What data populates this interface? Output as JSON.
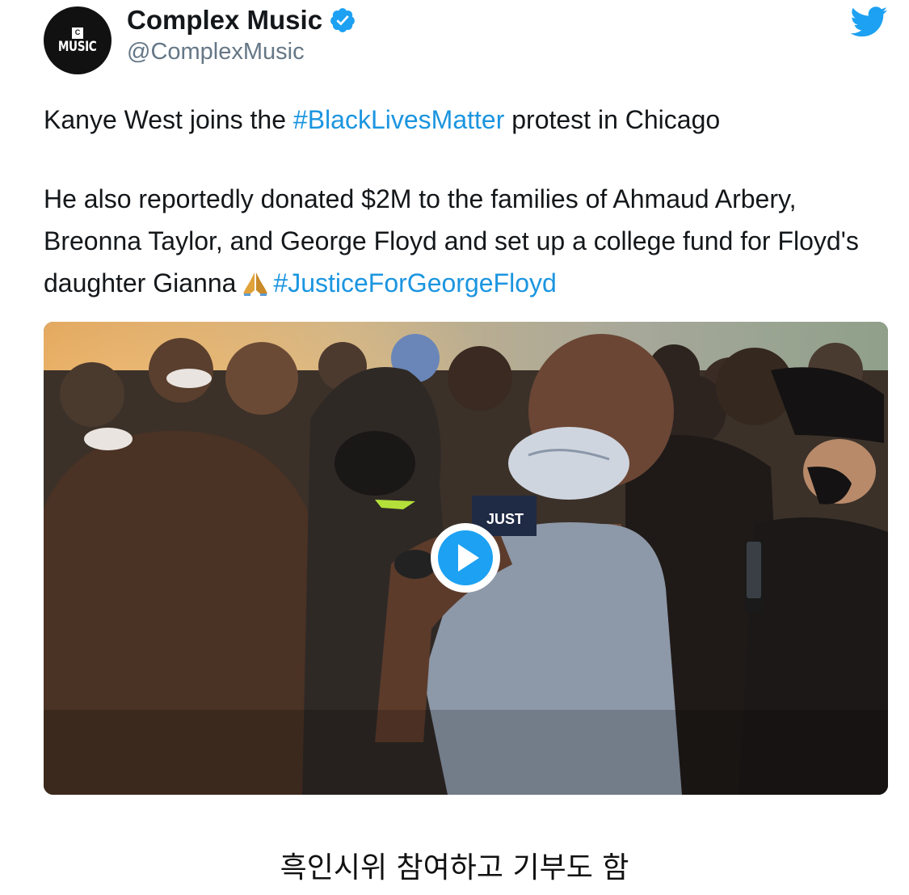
{
  "tweet": {
    "display_name": "Complex Music",
    "handle": "@ComplexMusic",
    "avatar_text": "MUSIC",
    "verified_icon": "verified-badge-icon",
    "platform_icon": "twitter-bird-icon",
    "text": {
      "line1_before": "Kanye West joins the ",
      "line1_hashtag": "#BlackLivesMatter",
      "line1_after": " protest in Chicago",
      "para2_main": "He also reportedly donated $2M to the families of Ahmaud Arbery, Breonna Taylor, and George Floyd and set up a college fund for Floyd's daughter Gianna",
      "emoji": "folded-hands-emoji",
      "para2_hashtag": "#JusticeForGeorgeFloyd"
    },
    "media": {
      "type": "video",
      "play_icon": "play-icon",
      "visible_text_on_shirt": "JUST"
    },
    "colors": {
      "hashtag": "#1b95e0",
      "verified": "#1da1f2",
      "twitter": "#1da1f2",
      "handle": "#657786"
    }
  },
  "caption": "흑인시위 참여하고 기부도 함"
}
